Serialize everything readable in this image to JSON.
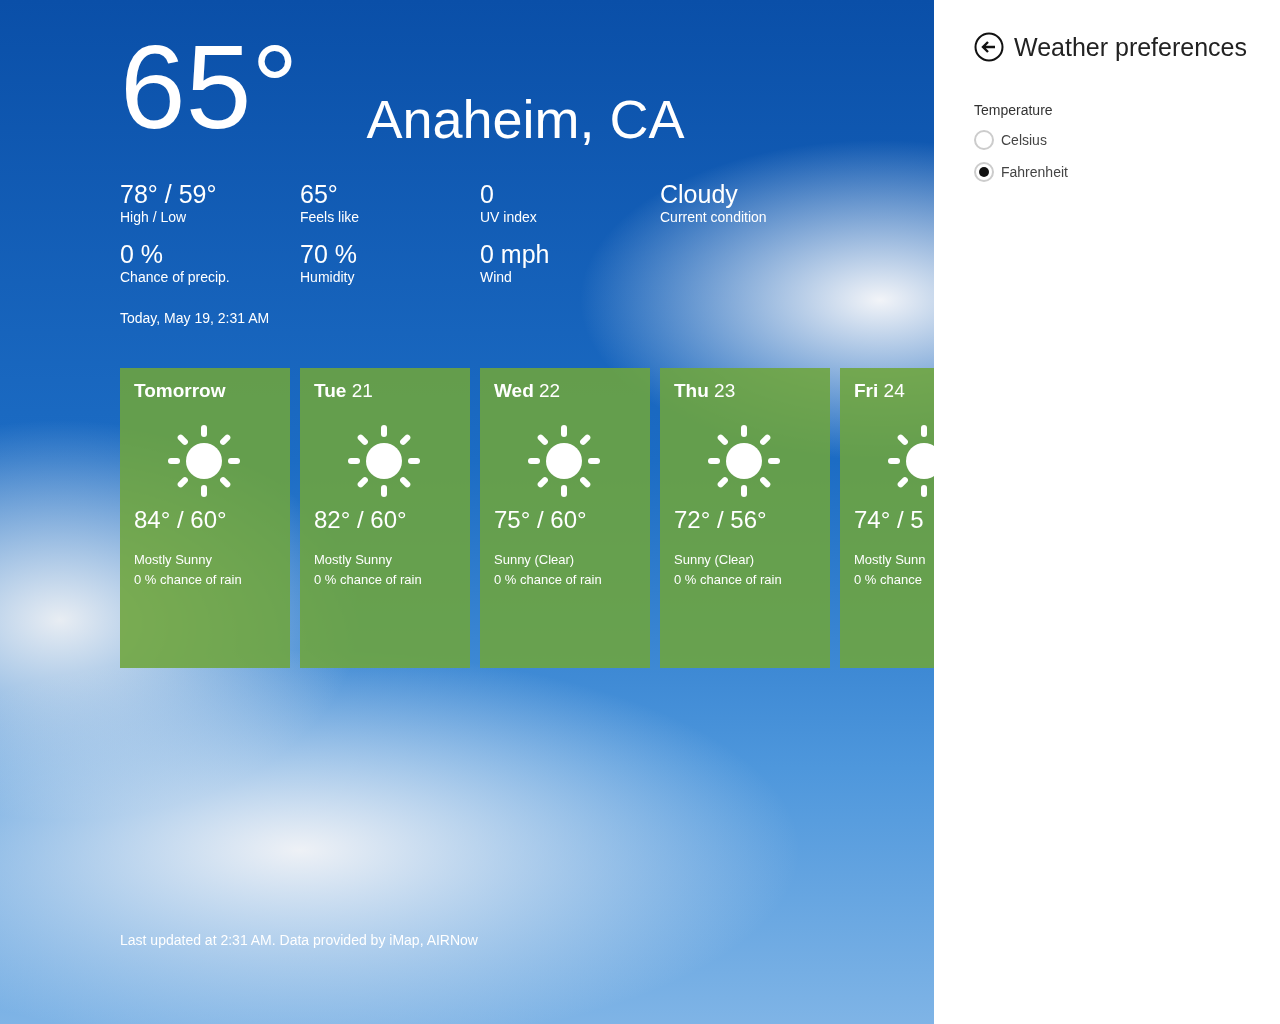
{
  "current": {
    "temperature": "65°",
    "location": "Anaheim, CA"
  },
  "details": [
    {
      "value": "78° / 59°",
      "label": "High / Low"
    },
    {
      "value": "65°",
      "label": "Feels like"
    },
    {
      "value": "0",
      "label": "UV index"
    },
    {
      "value": "Cloudy",
      "label": "Current condition"
    },
    {
      "value": "0 %",
      "label": "Chance of precip."
    },
    {
      "value": "70 %",
      "label": "Humidity"
    },
    {
      "value": "0 mph",
      "label": "Wind"
    }
  ],
  "timestamp": "Today, May 19, 2:31 AM",
  "forecast": [
    {
      "day": "Tomorrow",
      "temps": "84° / 60°",
      "condition": "Mostly Sunny",
      "rain": "0 % chance of rain"
    },
    {
      "day": "Tue",
      "date": "21",
      "temps": "82° / 60°",
      "condition": "Mostly Sunny",
      "rain": "0 % chance of rain"
    },
    {
      "day": "Wed",
      "date": "22",
      "temps": "75° / 60°",
      "condition": "Sunny (Clear)",
      "rain": "0 % chance of rain"
    },
    {
      "day": "Thu",
      "date": "23",
      "temps": "72° / 56°",
      "condition": "Sunny (Clear)",
      "rain": "0 % chance of rain"
    },
    {
      "day": "Fri",
      "date": "24",
      "temps": "74° / 5",
      "condition": "Mostly Sunn",
      "rain": "0 % chance"
    }
  ],
  "footer": "Last updated at 2:31 AM. Data provided by iMap, AIRNow",
  "preferences": {
    "title": "Weather preferences",
    "group_label": "Temperature",
    "options": [
      {
        "label": "Celsius",
        "selected": false
      },
      {
        "label": "Fahrenheit",
        "selected": true
      }
    ]
  }
}
